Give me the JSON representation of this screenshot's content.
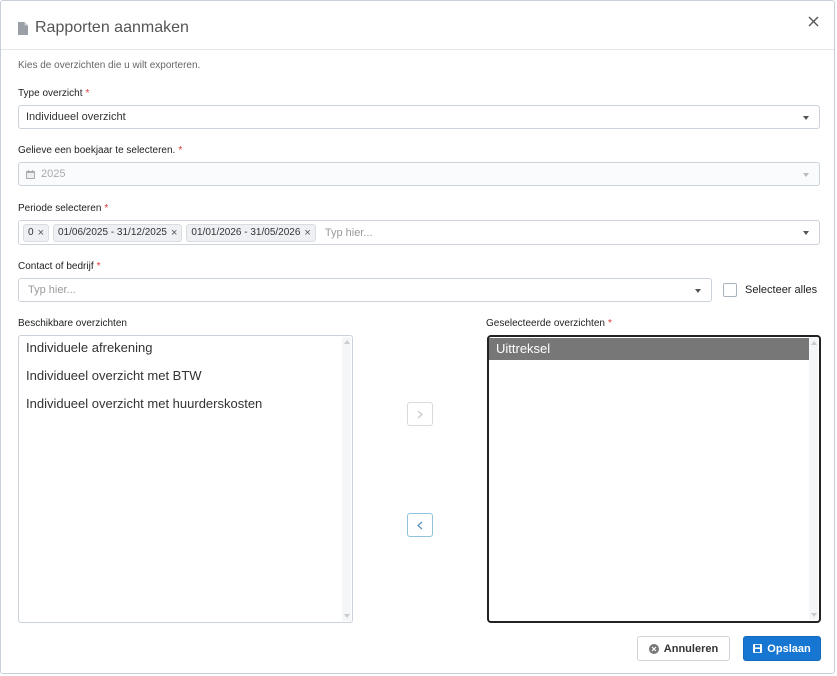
{
  "modal": {
    "title": "Rapporten aanmaken",
    "subtitle": "Kies de overzichten die u wilt exporteren."
  },
  "type_overzicht": {
    "label": "Type overzicht",
    "value": "Individueel overzicht"
  },
  "boekjaar": {
    "label": "Gelieve een boekjaar te selecteren.",
    "value": "2025"
  },
  "periode": {
    "label": "Periode selecteren",
    "tags": [
      "0",
      "01/06/2025 - 31/12/2025",
      "01/01/2026 - 31/05/2026"
    ],
    "placeholder": "Typ hier..."
  },
  "contact": {
    "label": "Contact of bedrijf",
    "placeholder": "Typ hier...",
    "select_all_label": "Selecteer alles"
  },
  "available": {
    "label": "Beschikbare overzichten",
    "items": [
      "Individuele afrekening",
      "Individueel overzicht met BTW",
      "Individueel overzicht met huurderskosten"
    ]
  },
  "selected": {
    "label": "Geselecteerde overzichten",
    "items": [
      "Uittreksel"
    ]
  },
  "footer": {
    "cancel_label": "Annuleren",
    "save_label": "Opslaan"
  },
  "required_marker": "*",
  "colors": {
    "primary": "#1676d2",
    "required": "#dd3333",
    "selected_item": "#777777"
  },
  "icons": [
    "document-icon",
    "close-icon",
    "calendar-icon",
    "chevron-right-icon",
    "chevron-left-icon",
    "cancel-circle-icon",
    "save-icon"
  ]
}
